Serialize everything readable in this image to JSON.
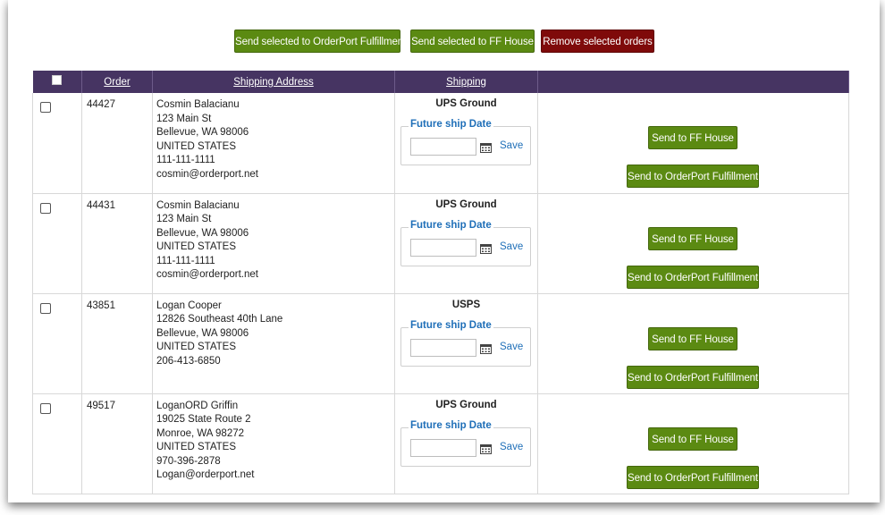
{
  "toolbar": {
    "send_orderport_label": "Send selected to OrderPort Fulfillment",
    "send_ff_label": "Send selected to FF House",
    "remove_label": "Remove selected orders"
  },
  "table": {
    "headers": {
      "order": "Order",
      "shipping_address": "Shipping Address",
      "shipping": "Shipping"
    },
    "rows": [
      {
        "order": "44427",
        "address": [
          "Cosmin Balacianu",
          "123 Main St",
          "Bellevue, WA 98006",
          "UNITED STATES",
          "111-111-1111",
          "cosmin@orderport.net"
        ],
        "shipping_method": "UPS Ground"
      },
      {
        "order": "44431",
        "address": [
          "Cosmin Balacianu",
          "123 Main St",
          "Bellevue, WA 98006",
          "UNITED STATES",
          "111-111-1111",
          "cosmin@orderport.net"
        ],
        "shipping_method": "UPS Ground"
      },
      {
        "order": "43851",
        "address": [
          "Logan Cooper",
          "12826 Southeast 40th Lane",
          "Bellevue, WA 98006",
          "UNITED STATES",
          "206-413-6850",
          ""
        ],
        "shipping_method": "USPS"
      },
      {
        "order": "49517",
        "address": [
          "LoganORD Griffin",
          "19025 State Route 2",
          "Monroe, WA 98272",
          "UNITED STATES",
          "970-396-2878",
          "Logan@orderport.net"
        ],
        "shipping_method": "UPS Ground"
      }
    ],
    "future_ship_legend": "Future ship Date",
    "save_label": "Save",
    "send_ff_row_label": "Send to FF House",
    "send_orderport_row_label": "Send to OrderPort Fulfillment"
  },
  "colors": {
    "header_bg": "#463462",
    "green_button": "#5b8a12",
    "red_button": "#7f0a0a",
    "link_blue": "#1f6fb8"
  }
}
